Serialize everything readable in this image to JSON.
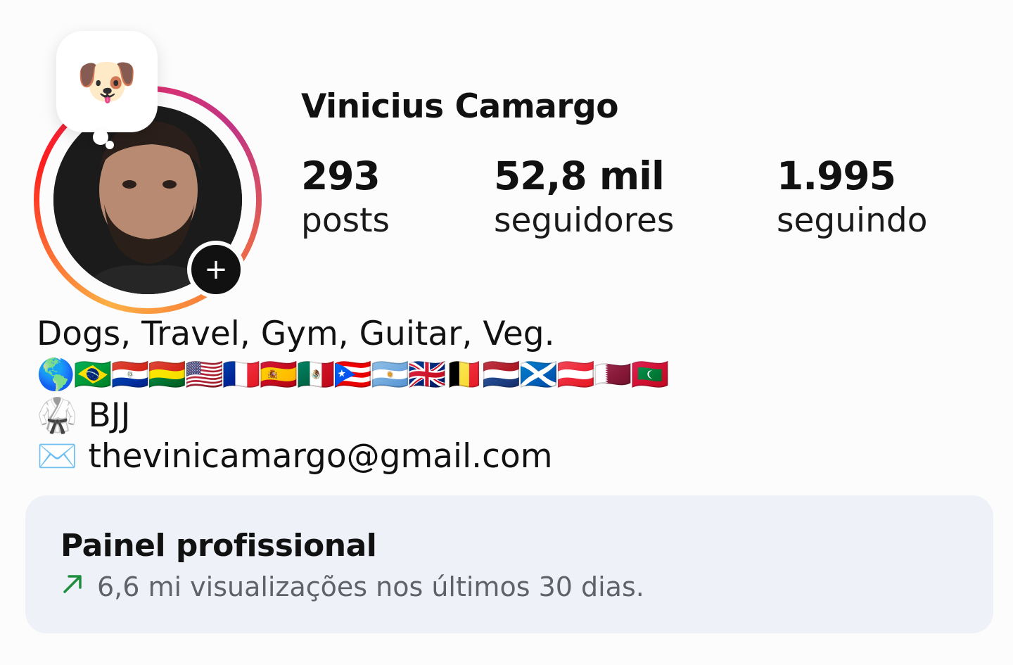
{
  "note": {
    "emoji": "🐶"
  },
  "profile": {
    "name": "Vinicius Camargo",
    "stats": [
      {
        "value": "293",
        "label": "posts"
      },
      {
        "value": "52,8 mil",
        "label": "seguidores"
      },
      {
        "value": "1.995",
        "label": "seguindo"
      }
    ]
  },
  "bio": {
    "line1": "Dogs, Travel, Gym, Guitar, Veg.",
    "flags": "🌎🇧🇷🇵🇾🇧🇴🇺🇸🇫🇷🇪🇸🇲🇽🇵🇷🇦🇷🇬🇧🇧🇪🇳🇱🏴󠁧󠁢󠁳󠁣󠁴󠁿🇦🇹🇶🇦🇲🇻",
    "line3": "🥋 BJJ",
    "line4": "✉️ thevinicamargo@gmail.com"
  },
  "panel": {
    "title": "Painel profissional",
    "subtitle": "6,6 mi visualizações nos últimos 30 dias.",
    "trend_color": "#1e8e3e"
  },
  "icons": {
    "add": "plus-icon",
    "trend": "trend-up-icon"
  }
}
